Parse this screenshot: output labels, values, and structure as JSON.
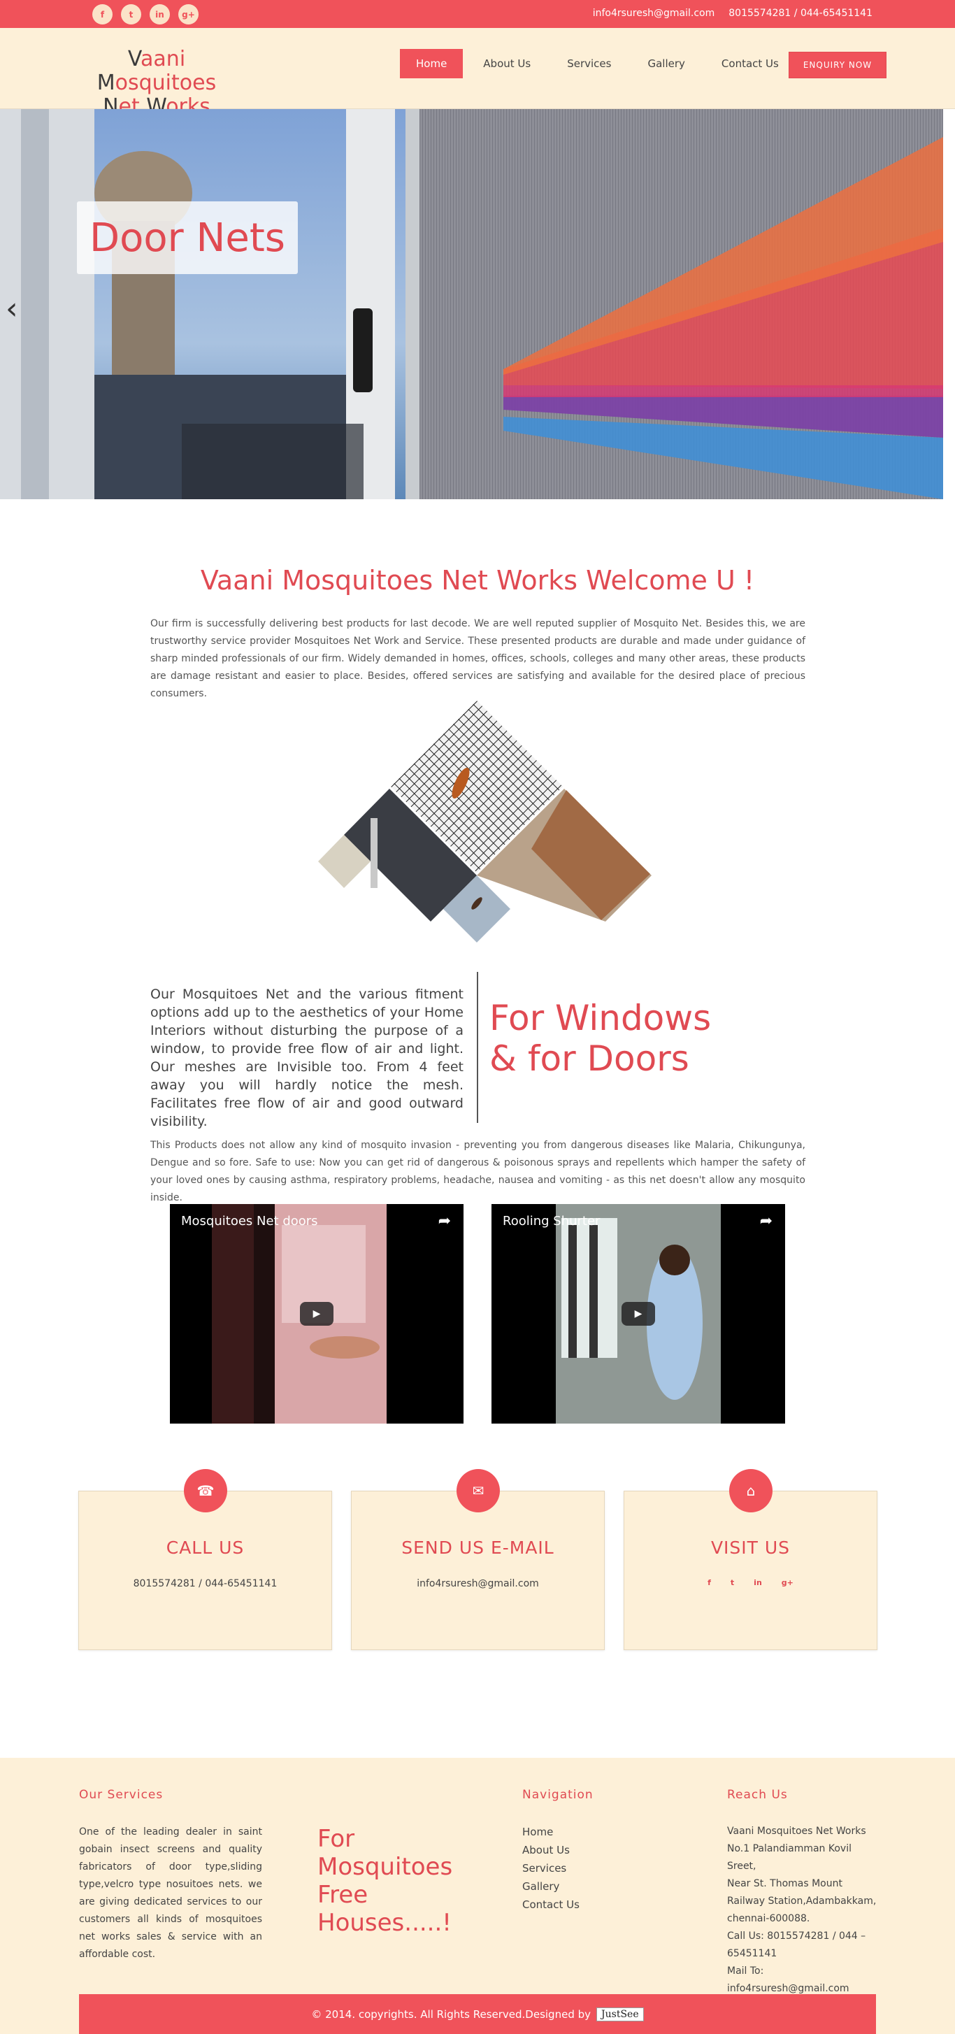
{
  "topbar": {
    "social": [
      {
        "icon": "facebook-icon",
        "glyph": "f"
      },
      {
        "icon": "twitter-icon",
        "glyph": "t"
      },
      {
        "icon": "linkedin-icon",
        "glyph": "in"
      },
      {
        "icon": "googleplus-icon",
        "glyph": "g+"
      }
    ],
    "email": "info4rsuresh@gmail.com",
    "phone": "8015574281 / 044-65451141"
  },
  "header": {
    "logo_line1_a": "V",
    "logo_line1_b": "aani ",
    "logo_line1_c": "M",
    "logo_line1_d": "osquitoes",
    "logo_line2_a": "N",
    "logo_line2_b": "et ",
    "logo_line2_c": "W",
    "logo_line2_d": "orks",
    "nav": [
      "Home",
      "About Us",
      "Services",
      "Gallery",
      "Contact Us"
    ],
    "enquiry": "ENQUIRY NOW"
  },
  "hero": {
    "title": "Door Nets",
    "prev_arrow": "‹"
  },
  "welcome": {
    "title": "Vaani Mosquitoes Net Works Welcome U !",
    "text": "Our firm is successfully delivering best products for last decode. We are well reputed supplier of Mosquito Net. Besides this, we are trustworthy service provider Mosquitoes Net Work and Service. These presented products are durable and made under guidance of sharp minded professionals of our firm. Widely demanded in homes, offices, schools, colleges and many other areas, these products are damage resistant and easier to place. Besides, offered services are satisfying and available for the desired place of precious consumers."
  },
  "fitment": {
    "text": "Our Mosquitoes Net and the various fitment options add up to the aesthetics of your Home Interiors without disturbing the purpose of a window, to provide free flow of air and light. Our meshes are Invisible too. From 4 feet away you will hardly notice the mesh. Facilitates free flow of air and good outward visibility.",
    "title_line1": "For Windows",
    "title_line2": "& for Doors"
  },
  "protect": {
    "text": "This Products does not allow any kind of mosquito invasion - preventing you from dangerous diseases like Malaria, Chikungunya, Dengue and so fore. Safe to use: Now you can get rid of dangerous & poisonous sprays and repellents which hamper the safety of your loved ones by causing asthma, respiratory problems, headache, nausea and vomiting - as this net doesn't allow any mosquito inside."
  },
  "videos": [
    {
      "title": "Mosquitoes Net doors"
    },
    {
      "title": "Rooling Shurter"
    }
  ],
  "contact_boxes": {
    "call": {
      "title": "CALL US",
      "text": "8015574281 / 044-65451141",
      "icon": "phone-icon"
    },
    "email": {
      "title": "SEND US E-MAIL",
      "text": "info4rsuresh@gmail.com",
      "icon": "envelope-icon"
    },
    "visit": {
      "title": "VISIT US",
      "icon": "home-icon"
    }
  },
  "footer": {
    "services_heading": "Our Services",
    "services_text": "One of the leading dealer in saint gobain insect screens and quality fabricators of door type,sliding type,velcro type nosuitoes nets. we are giving dedicated services to our customers all kinds of mosquitoes net works sales & service with an affordable cost.",
    "slogan": [
      "For",
      "Mosquitoes",
      "Free",
      "Houses.....!"
    ],
    "nav_heading": "Navigation",
    "nav": [
      "Home",
      "About Us",
      "Services",
      "Gallery",
      "Contact Us"
    ],
    "reach_heading": "Reach Us",
    "reach_lines": [
      "Vaani Mosquitoes Net Works",
      "No.1 Palandiamman Kovil Sreet,",
      "Near St. Thomas  Mount",
      "Railway Station,Adambakkam,",
      "chennai-600088.",
      "Call Us: 8015574281 / 044 –",
      "65451141",
      "Mail To:",
      "info4rsuresh@gmail.com"
    ],
    "copyright": "© 2014. copyrights. All Rights Reserved.Designed by",
    "designer": "JustSee"
  },
  "colors": {
    "accent": "#f0525a",
    "cream": "#fdf0d8"
  }
}
